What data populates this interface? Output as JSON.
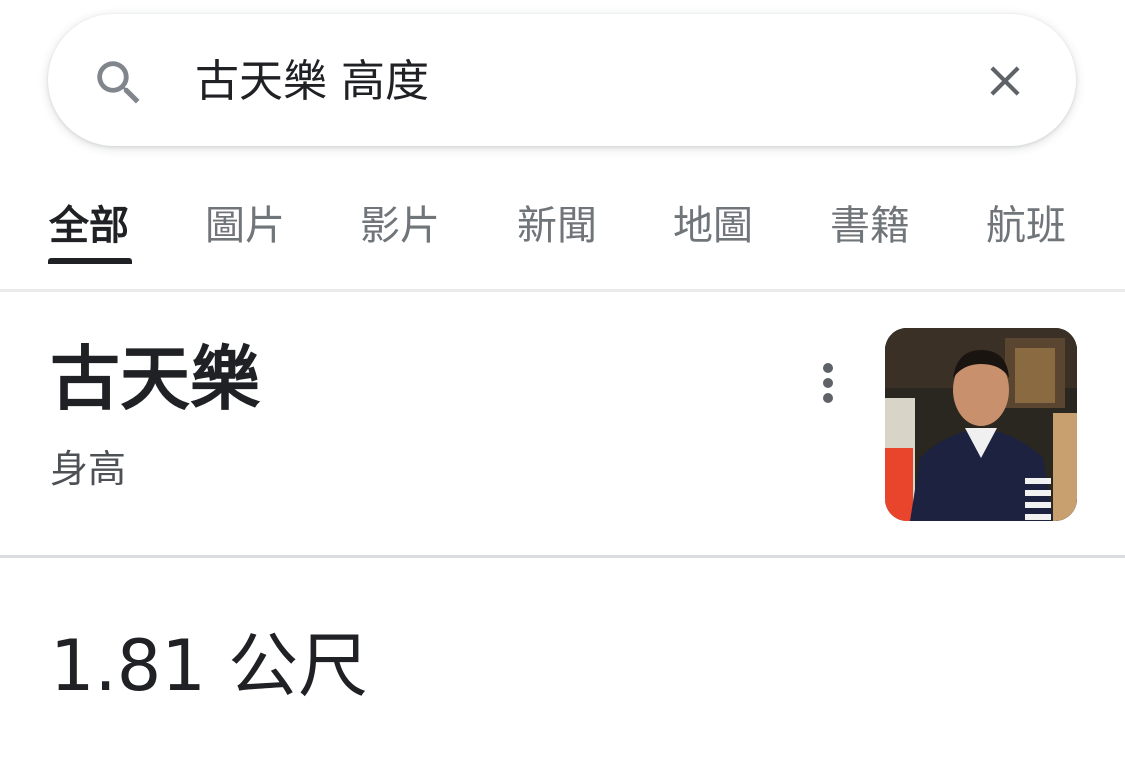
{
  "search": {
    "query": "古天樂 高度",
    "search_icon": "search-icon",
    "clear_icon": "close-icon"
  },
  "tabs": [
    {
      "label": "全部",
      "active": true
    },
    {
      "label": "圖片",
      "active": false
    },
    {
      "label": "影片",
      "active": false
    },
    {
      "label": "新聞",
      "active": false
    },
    {
      "label": "地圖",
      "active": false
    },
    {
      "label": "書籍",
      "active": false
    },
    {
      "label": "航班",
      "active": false
    }
  ],
  "entity": {
    "name": "古天樂",
    "attribute": "身高",
    "more_icon": "more-vert-icon",
    "thumbnail": "person-photo"
  },
  "answer": {
    "value": "1.81 公尺"
  },
  "colors": {
    "text_primary": "#202124",
    "text_secondary": "#70757a",
    "divider": "#dadce0",
    "icon": "#70757a"
  }
}
